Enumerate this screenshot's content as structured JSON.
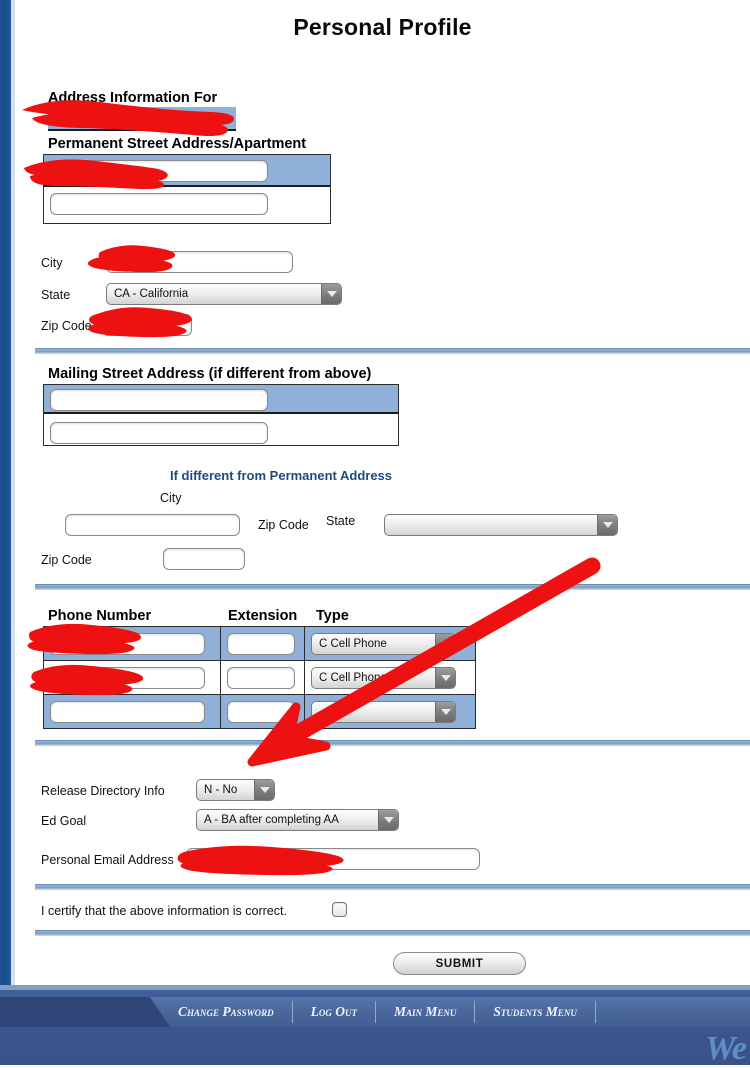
{
  "page": {
    "title": "Personal Profile"
  },
  "permanent_address": {
    "section_label": "Address Information For",
    "street_label": "Permanent Street Address/Apartment",
    "street_line1_value": "",
    "street_line2_value": "",
    "city_label": "City",
    "city_value": "",
    "state_label": "State",
    "state_value": "CA - California",
    "zip_label": "Zip Code",
    "zip_value": ""
  },
  "mailing_address": {
    "section_label": "Mailing Street Address (if different from above)",
    "note": "If different from Permanent Address",
    "street_line1_value": "",
    "street_line2_value": "",
    "city_label": "City",
    "city_value": "",
    "zip_label_inline": "Zip Code",
    "state_label": "State",
    "state_value": "",
    "zip_label": "Zip Code",
    "zip_value": ""
  },
  "phones": {
    "headers": [
      "Phone Number",
      "Extension",
      "Type"
    ],
    "rows": [
      {
        "number": "",
        "extension": "",
        "type": "C Cell Phone"
      },
      {
        "number": "",
        "extension": "",
        "type": "C Cell Phone"
      },
      {
        "number": "",
        "extension": "",
        "type": ""
      }
    ]
  },
  "misc": {
    "release_label": "Release Directory Info",
    "release_value": "N - No",
    "ed_goal_label": "Ed Goal",
    "ed_goal_value": "A - BA after completing AA",
    "email_label": "Personal Email Address",
    "email_value": ""
  },
  "certify": {
    "text": "I certify that the above information is correct.",
    "checked": false
  },
  "submit": {
    "label": "SUBMIT"
  },
  "footer": {
    "nav": [
      {
        "label": "Change Password"
      },
      {
        "label": "Log Out"
      },
      {
        "label": "Main Menu"
      },
      {
        "label": "Students Menu"
      }
    ],
    "brand_partial": "We"
  },
  "colors": {
    "rail_blue": "#1f4f94",
    "highlight_blue": "#8fb0d8",
    "divider_blue": "#7d9cc2",
    "link_blue": "#1f4a80",
    "footer_blue": "#3c5790",
    "redaction_red": "#ee1111"
  }
}
